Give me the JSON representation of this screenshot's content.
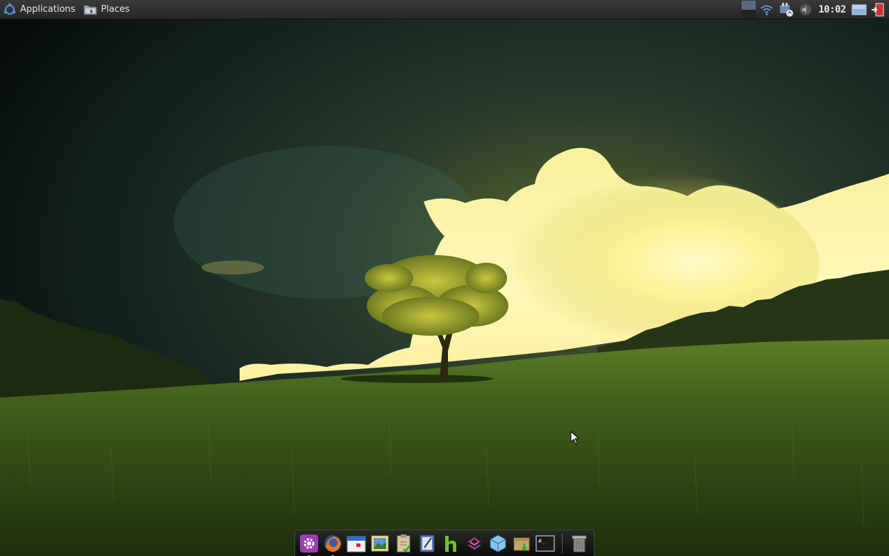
{
  "top_panel": {
    "applications_label": "Applications",
    "places_label": "Places",
    "clock": "10:02"
  },
  "tray_icons": [
    "workspace-icon",
    "wifi-icon",
    "network-icon",
    "volume-icon",
    "clock",
    "show-desktop-icon",
    "logout-icon"
  ],
  "dock": {
    "items": [
      {
        "name": "settings-icon",
        "running": true
      },
      {
        "name": "firefox-icon",
        "running": true
      },
      {
        "name": "calendar-icon",
        "running": false
      },
      {
        "name": "image-viewer-icon",
        "running": false
      },
      {
        "name": "clipboard-icon",
        "running": false
      },
      {
        "name": "text-editor-icon",
        "running": false
      },
      {
        "name": "hexchat-icon",
        "running": false
      },
      {
        "name": "sync-icon",
        "running": false
      },
      {
        "name": "virtualbox-icon",
        "running": false
      },
      {
        "name": "archive-manager-icon",
        "running": false
      },
      {
        "name": "terminal-icon",
        "running": false
      },
      {
        "name": "trash-icon",
        "running": false
      }
    ]
  },
  "colors": {
    "panel_bg": "#2e2e2e",
    "sky_dark": "#0e1a16",
    "cloud_light": "#fff3a8",
    "grass": "#3d5a1c"
  }
}
